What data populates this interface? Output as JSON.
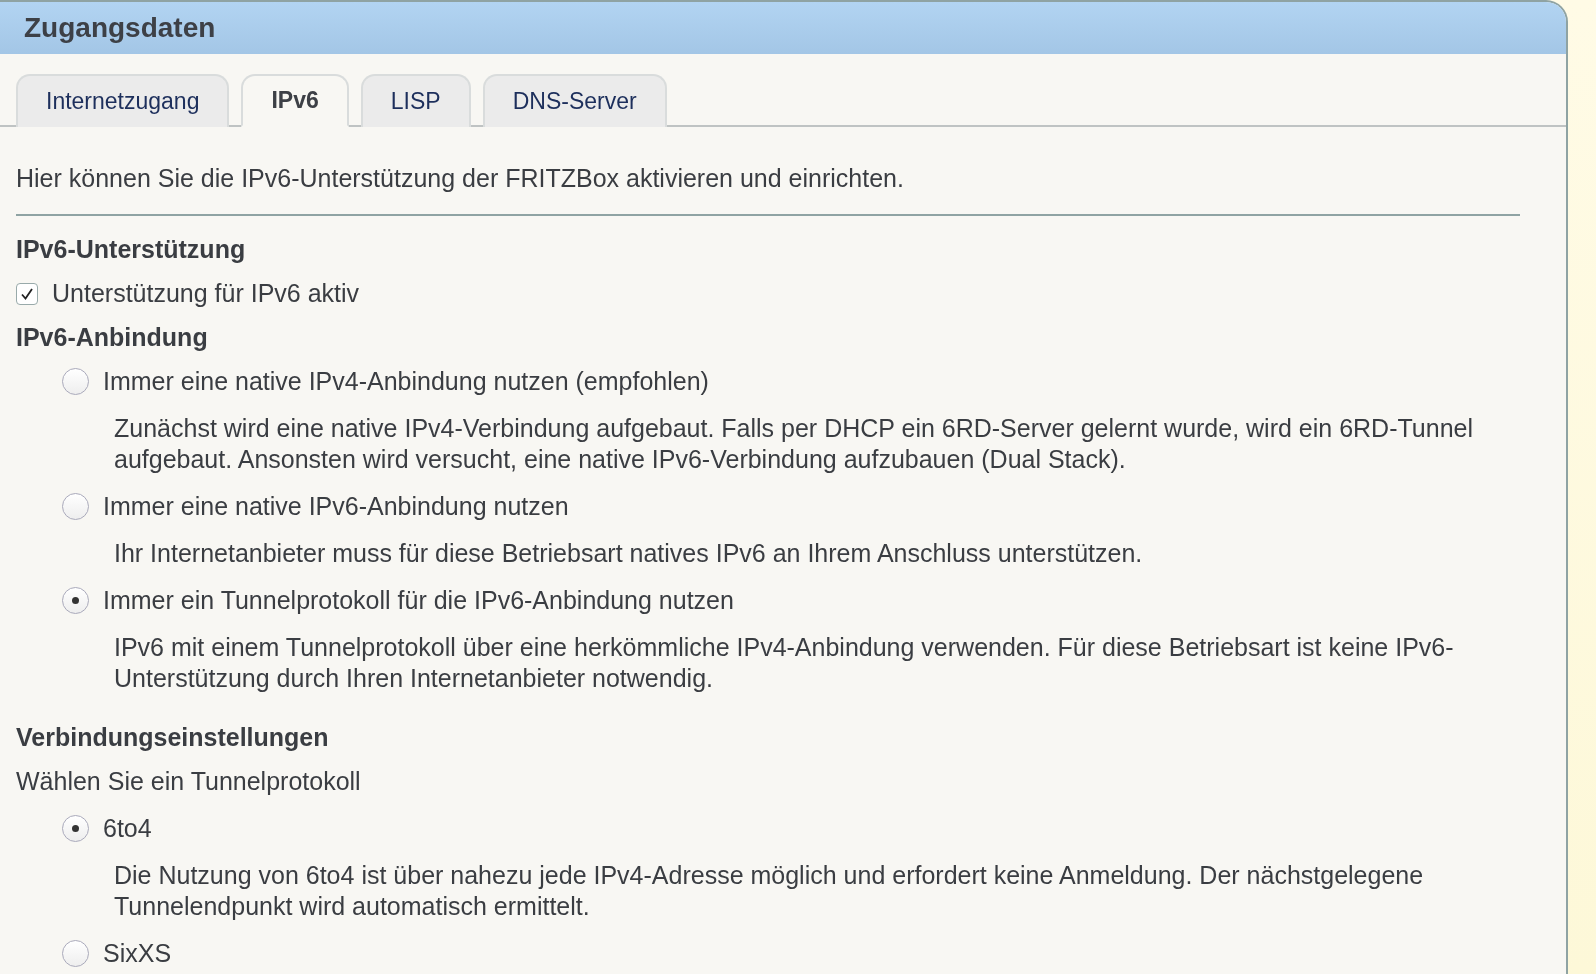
{
  "panel": {
    "title": "Zugangsdaten"
  },
  "tabs": [
    {
      "label": "Internetzugang",
      "selected": false
    },
    {
      "label": "IPv6",
      "selected": true
    },
    {
      "label": "LISP",
      "selected": false
    },
    {
      "label": "DNS-Server",
      "selected": false
    }
  ],
  "intro": "Hier können Sie die IPv6-Unterstützung der FRITZBox aktivieren und einrichten.",
  "sections": [
    {
      "heading": "IPv6-Unterstützung",
      "items": [
        {
          "kind": "checkbox",
          "label": "Unterstützung für IPv6 aktiv",
          "checked": true
        }
      ]
    },
    {
      "heading": "IPv6-Anbindung",
      "items": [
        {
          "kind": "radio",
          "label": "Immer eine native IPv4-Anbindung nutzen (empfohlen)",
          "selected": false,
          "description": "Zunächst wird eine native IPv4-Verbindung aufgebaut. Falls per DHCP ein 6RD-Server gelernt wurde, wird ein 6RD-Tunnel aufgebaut. Ansonsten wird versucht, eine native IPv6-Verbindung aufzubauen (Dual Stack)."
        },
        {
          "kind": "radio",
          "label": "Immer eine native IPv6-Anbindung nutzen",
          "selected": false,
          "description": "Ihr Internetanbieter muss für diese Betriebsart natives IPv6 an Ihrem Anschluss unterstützen."
        },
        {
          "kind": "radio",
          "label": "Immer ein Tunnelprotokoll für die IPv6-Anbindung nutzen",
          "selected": true,
          "description": "IPv6 mit einem Tunnelprotokoll über eine herkömmliche IPv4-Anbindung verwenden. Für diese Betriebsart ist keine IPv6-Unterstützung durch Ihren Internetanbieter notwendig."
        }
      ]
    },
    {
      "heading": "Verbindungseinstellungen",
      "items": [
        {
          "kind": "text",
          "text": "Wählen Sie ein Tunnelprotokoll"
        },
        {
          "kind": "radio",
          "label": "6to4",
          "selected": true,
          "description": "Die Nutzung von 6to4 ist über nahezu jede IPv4-Adresse möglich und erfordert keine Anmeldung. Der nächstgelegene Tunnelendpunkt wird automatisch ermittelt."
        },
        {
          "kind": "radio",
          "label": "SixXS",
          "selected": false
        }
      ]
    }
  ]
}
